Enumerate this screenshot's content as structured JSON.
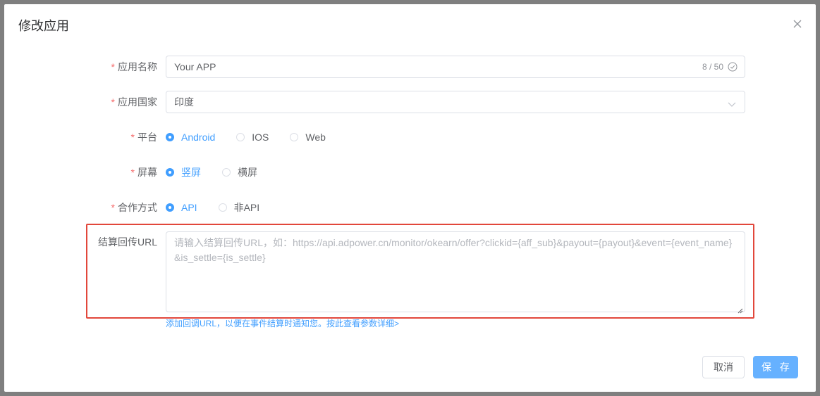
{
  "dialog": {
    "title": "修改应用",
    "close_icon": "close-icon"
  },
  "form": {
    "app_name": {
      "required_mark": "*",
      "label": "应用名称",
      "value": "Your APP",
      "count": "8 / 50"
    },
    "app_country": {
      "required_mark": "*",
      "label": "应用国家",
      "value": "印度"
    },
    "platform": {
      "required_mark": "*",
      "label": "平台",
      "options": [
        "Android",
        "IOS",
        "Web"
      ],
      "selected": "Android"
    },
    "screen": {
      "required_mark": "*",
      "label": "屏幕",
      "options": [
        "竖屏",
        "横屏"
      ],
      "selected": "竖屏"
    },
    "coop_mode": {
      "required_mark": "*",
      "label": "合作方式",
      "options": [
        "API",
        "非API"
      ],
      "selected": "API"
    },
    "callback_url": {
      "label": "结算回传URL",
      "placeholder": "请输入结算回传URL，如：https://api.adpower.cn/monitor/okearn/offer?clickid={aff_sub}&payout={payout}&event={event_name}&is_settle={is_settle}",
      "hint": "添加回调URL，以便在事件结算时通知您。按此查看参数详细>"
    }
  },
  "footer": {
    "cancel_label": "取消",
    "save_label": "保 存"
  },
  "colors": {
    "primary": "#409eff",
    "save_button": "#66b1ff",
    "required": "#f56c6c",
    "highlight_border": "#e2473b"
  }
}
